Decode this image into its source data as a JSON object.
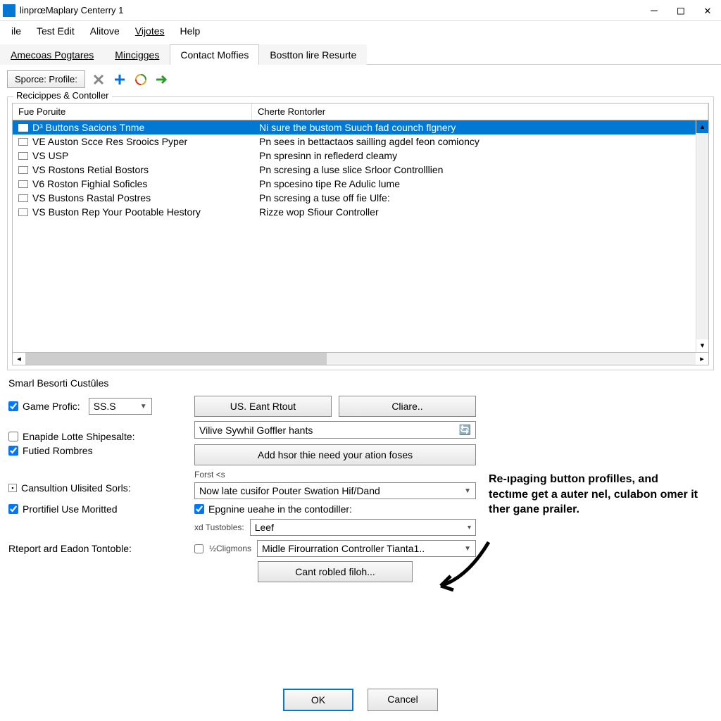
{
  "window": {
    "title": "linprœMaplary Centerry 1"
  },
  "menu": [
    "ile",
    "Test Edit",
    "Alitove",
    "Vijotes",
    "Help"
  ],
  "tabs": {
    "items": [
      "Amecoas Pogtares",
      "Mincigges",
      "Contact Moffies",
      "Bostton lire Resurte"
    ],
    "active": 2
  },
  "toolbar": {
    "sporce": "Sporce: Profile:"
  },
  "recipes": {
    "legend": "Recicippes & Contoller",
    "columns": [
      "Fue Poruite",
      "Cherte Rontorler"
    ],
    "rows": [
      {
        "c1": "D³ Buttons Sacions Tnme",
        "c2": "Ni sure the bustom Suuch fad counch flgnery",
        "sel": true
      },
      {
        "c1": "VE Auston Scce Res Srooics Pyper",
        "c2": "Pn sees in bettactaos sailling agdel feon comioncy"
      },
      {
        "c1": "VS USP",
        "c2": "Pn spresinn in reflederd cleamy"
      },
      {
        "c1": "VS Rostons Retial Bostors",
        "c2": "Pn scresing a luse slice Srloor Controlllien"
      },
      {
        "c1": "V6 Roston Fighial Soficles",
        "c2": "Pn spcesino tipe Re Adulic lume"
      },
      {
        "c1": "VS Bustons Rastal Postres",
        "c2": "Pn scresing a tuse off fie Ulfe:"
      },
      {
        "c1": "VS Buston Rep Your Pootable Hestory",
        "c2": "Rizze wop Sfiour Controller"
      }
    ]
  },
  "section2": "Smarl Besorti Custûles",
  "form": {
    "game_profic_label": "Game Profic:",
    "game_profic_value": "SS.S",
    "us_btn": "US. Eant Rtout",
    "clare_btn": "Cliare..",
    "enapide": "Enapide Lotte Shipesalte:",
    "futied": "Futied Rombres",
    "vive_field": "Vilive Sywhil Goffler hants",
    "add_btn": "Add hsor thie need your ation foses",
    "canultion": "Cansultion Ulisited Sorls:",
    "forst": "Forst <s",
    "now_late": "Now late cusifor Pouter Swation Hif/Dand",
    "prortified": "Prortifiel Use Moritted",
    "epgnine": "Epgnine ueahe in the contodiller:",
    "tustobles_label": "xd Tustobles:",
    "tustobles_value": "Leef",
    "report_label": "Rteport ard Eadon Tontoble:",
    "cligmons_label": "½Cligmons",
    "cligmons_value": "Midle Firourration Controller Tianta1..",
    "cant_btn": "Cant robled filoh..."
  },
  "annotation": "Re-ıpaging button profilles, and tectıme get a auter nel, culabon omer it ther gane prailer.",
  "footer": {
    "ok": "OK",
    "cancel": "Cancel"
  }
}
